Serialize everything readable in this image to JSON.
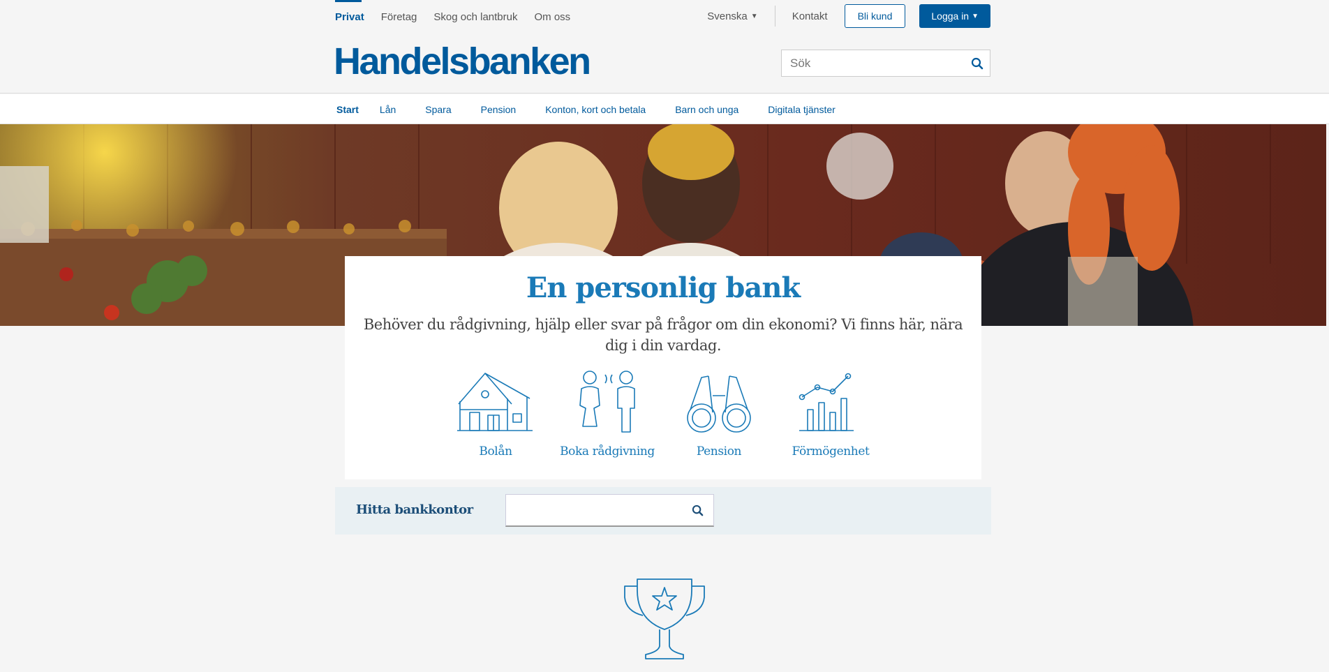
{
  "segments": [
    {
      "label": "Privat",
      "active": true
    },
    {
      "label": "Företag",
      "active": false
    },
    {
      "label": "Skog och lantbruk",
      "active": false
    },
    {
      "label": "Om oss",
      "active": false
    }
  ],
  "top_right": {
    "language": "Svenska",
    "contact": "Kontakt",
    "become_customer": "Bli kund",
    "login": "Logga in"
  },
  "logo_text": "Handelsbanken",
  "search": {
    "placeholder": "Sök",
    "value": ""
  },
  "main_nav": [
    {
      "label": "Start",
      "active": true
    },
    {
      "label": "Lån",
      "active": false
    },
    {
      "label": "Spara",
      "active": false
    },
    {
      "label": "Pension",
      "active": false
    },
    {
      "label": "Konton, kort och betala",
      "active": false
    },
    {
      "label": "Barn och unga",
      "active": false
    },
    {
      "label": "Digitala tjänster",
      "active": false
    }
  ],
  "hero": {
    "title": "En personlig bank",
    "text": "Behöver du rådgivning, hjälp eller svar på frågor om din ekonomi? Vi finns här, nära dig i din vardag."
  },
  "shortcuts": [
    {
      "label": "Bolån",
      "icon": "house-icon"
    },
    {
      "label": "Boka rådgivning",
      "icon": "people-icon"
    },
    {
      "label": "Pension",
      "icon": "binoculars-icon"
    },
    {
      "label": "Förmögenhet",
      "icon": "growth-chart-icon"
    }
  ],
  "branch_finder": {
    "label": "Hitta bankkontor",
    "value": ""
  },
  "colors": {
    "brand": "#005a9c",
    "icon": "#1a7ab7",
    "background": "#f5f5f5",
    "branch_bg": "#e9f0f3"
  }
}
